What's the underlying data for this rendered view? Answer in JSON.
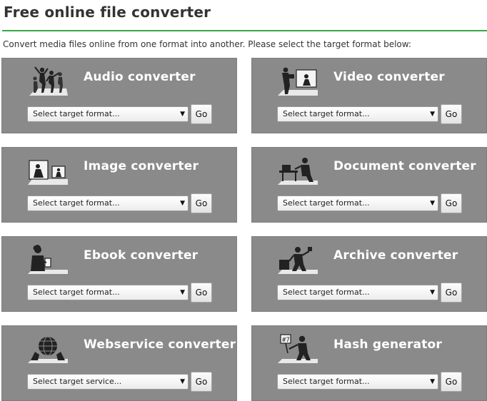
{
  "page": {
    "title": "Free online file converter",
    "intro": "Convert media files online from one format into another. Please select the target format below:"
  },
  "icons": {
    "dropdown": "triangle-down",
    "audio": "dancing-people-icon",
    "video": "video-projector-icon",
    "image": "photo-frames-icon",
    "document": "person-at-desk-icon",
    "ebook": "person-reading-tablet-icon",
    "archive": "person-with-box-icon",
    "webservice": "globe-hands-icon",
    "hash": "person-holding-sign-icon"
  },
  "colors": {
    "accent_rule": "#33a845",
    "card_bg": "#8a8a8a",
    "card_title": "#ffffff"
  },
  "cards": [
    {
      "title": "Audio converter",
      "select": "Select target format...",
      "go": "Go"
    },
    {
      "title": "Video converter",
      "select": "Select target format...",
      "go": "Go"
    },
    {
      "title": "Image converter",
      "select": "Select target format...",
      "go": "Go"
    },
    {
      "title": "Document converter",
      "select": "Select target format...",
      "go": "Go"
    },
    {
      "title": "Ebook converter",
      "select": "Select target format...",
      "go": "Go"
    },
    {
      "title": "Archive converter",
      "select": "Select target format...",
      "go": "Go"
    },
    {
      "title": "Webservice converter",
      "select": "Select target service...",
      "go": "Go"
    },
    {
      "title": "Hash generator",
      "select": "Select target format...",
      "go": "Go"
    }
  ]
}
